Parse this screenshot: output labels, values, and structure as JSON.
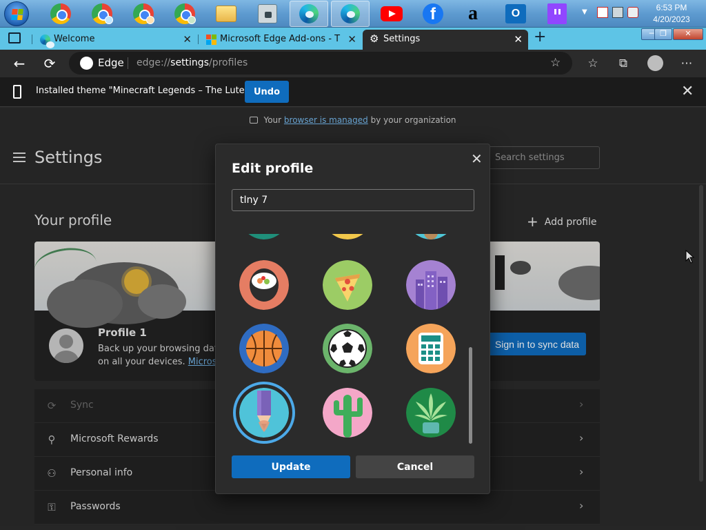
{
  "taskbar": {
    "apps": [
      "Windows Start",
      "Google Chrome",
      "Google Chrome",
      "Google Chrome",
      "Google Chrome",
      "File Explorer",
      "Security app",
      "Microsoft Edge",
      "Microsoft Edge",
      "YouTube",
      "Facebook",
      "Amazon",
      "Outlook",
      "Twitch"
    ],
    "clock_time": "6:53 PM",
    "clock_date": "4/20/2023"
  },
  "tabs": [
    {
      "label": "Welcome",
      "icon": "edge-icon"
    },
    {
      "label": "Microsoft Edge Add-ons - Theme",
      "icon": "microsoft-icon"
    },
    {
      "label": "Settings",
      "icon": "gear-icon",
      "active": true
    }
  ],
  "address": {
    "browser_label": "Edge",
    "url_prefix": "edge://",
    "url_bold": "settings",
    "url_suffix": "/profiles"
  },
  "notification": {
    "message": "Installed theme \"Minecraft Legends – The Lute\"",
    "undo_label": "Undo"
  },
  "managed": {
    "prefix": "Your",
    "link": "browser is managed",
    "suffix": "by your organization"
  },
  "settings": {
    "title": "Settings",
    "search_placeholder": "Search settings",
    "your_profile": "Your profile",
    "add_profile": "Add profile",
    "profile_name": "Profile 1",
    "profile_desc_line1": "Back up your browsing data",
    "profile_desc_line2_prefix": "on all your devices.",
    "profile_desc_link": "Microso",
    "sync_button": "Sign in to sync data",
    "list": [
      {
        "label": "Sync",
        "icon": "sync-icon",
        "dim": true
      },
      {
        "label": "Microsoft Rewards",
        "icon": "trophy-icon"
      },
      {
        "label": "Personal info",
        "icon": "person-card-icon"
      },
      {
        "label": "Passwords",
        "icon": "key-icon"
      }
    ]
  },
  "dialog": {
    "title": "Edit profile",
    "name_value": "tIny 7",
    "update_label": "Update",
    "cancel_label": "Cancel",
    "avatars": [
      "sushi-avatar",
      "pizza-avatar",
      "city-avatar",
      "basketball-avatar",
      "soccer-ball-avatar",
      "calculator-avatar",
      "pencil-avatar",
      "cactus-avatar",
      "plant-avatar"
    ],
    "selected_avatar": "pencil-avatar"
  },
  "colors": {
    "accent": "#0f6cbd",
    "tab_strip": "#5ec4e6",
    "page_bg": "#2b2b2b"
  }
}
